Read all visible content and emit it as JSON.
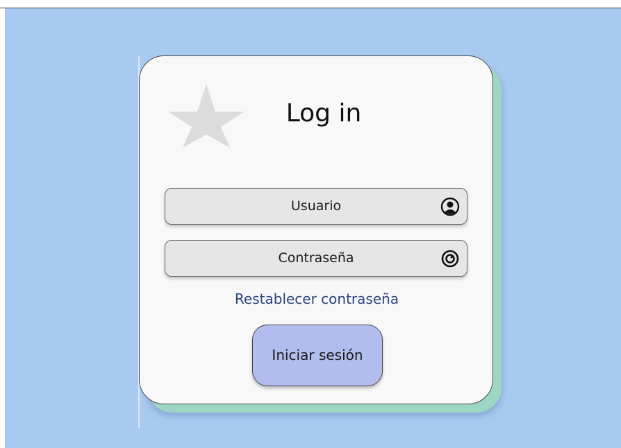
{
  "title": "Log in",
  "logo_icon": "star-icon",
  "fields": {
    "username": {
      "placeholder": "Usuario",
      "icon": "user-circle-icon"
    },
    "password": {
      "placeholder": "Contraseña",
      "icon": "eye-icon"
    }
  },
  "reset_link": "Restablecer contraseña",
  "submit_label": "Iniciar sesión",
  "colors": {
    "background": "#a8caf0",
    "card": "#f8f8f8",
    "card_shadow": "#9ed6c6",
    "field": "#e6e6e6",
    "button": "#b3bcef",
    "link": "#2a4480",
    "logo": "#dcdcdc"
  }
}
